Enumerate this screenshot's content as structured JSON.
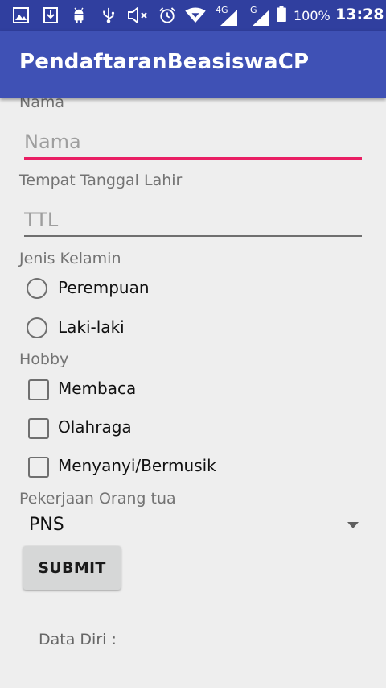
{
  "status_bar": {
    "network_4g": "4G",
    "network_g": "G",
    "battery_percent": "100%",
    "time": "13:28",
    "icons": [
      "image-icon",
      "download-icon",
      "android-icon",
      "usb-icon",
      "mute-icon",
      "alarm-icon",
      "wifi-icon",
      "signal-4g-icon",
      "signal-g-icon",
      "battery-icon"
    ]
  },
  "app_bar": {
    "title": "PendaftaranBeasiswaCP"
  },
  "form": {
    "nama": {
      "label": "Nama",
      "placeholder": "Nama",
      "value": ""
    },
    "ttl": {
      "label": "Tempat Tanggal Lahir",
      "placeholder": "TTL",
      "value": ""
    },
    "gender": {
      "label": "Jenis Kelamin",
      "options": [
        "Perempuan",
        "Laki-laki"
      ]
    },
    "hobby": {
      "label": "Hobby",
      "options": [
        "Membaca",
        "Olahraga",
        "Menyanyi/Bermusik"
      ]
    },
    "pekerjaan": {
      "label": "Pekerjaan Orang tua",
      "selected": "PNS"
    },
    "submit_label": "SUBMIT",
    "data_label": "Data Diri :"
  },
  "colors": {
    "status_bar": "#303f9f",
    "app_bar": "#3f51b5",
    "focus_accent": "#e91e63",
    "background": "#eeeeee"
  }
}
